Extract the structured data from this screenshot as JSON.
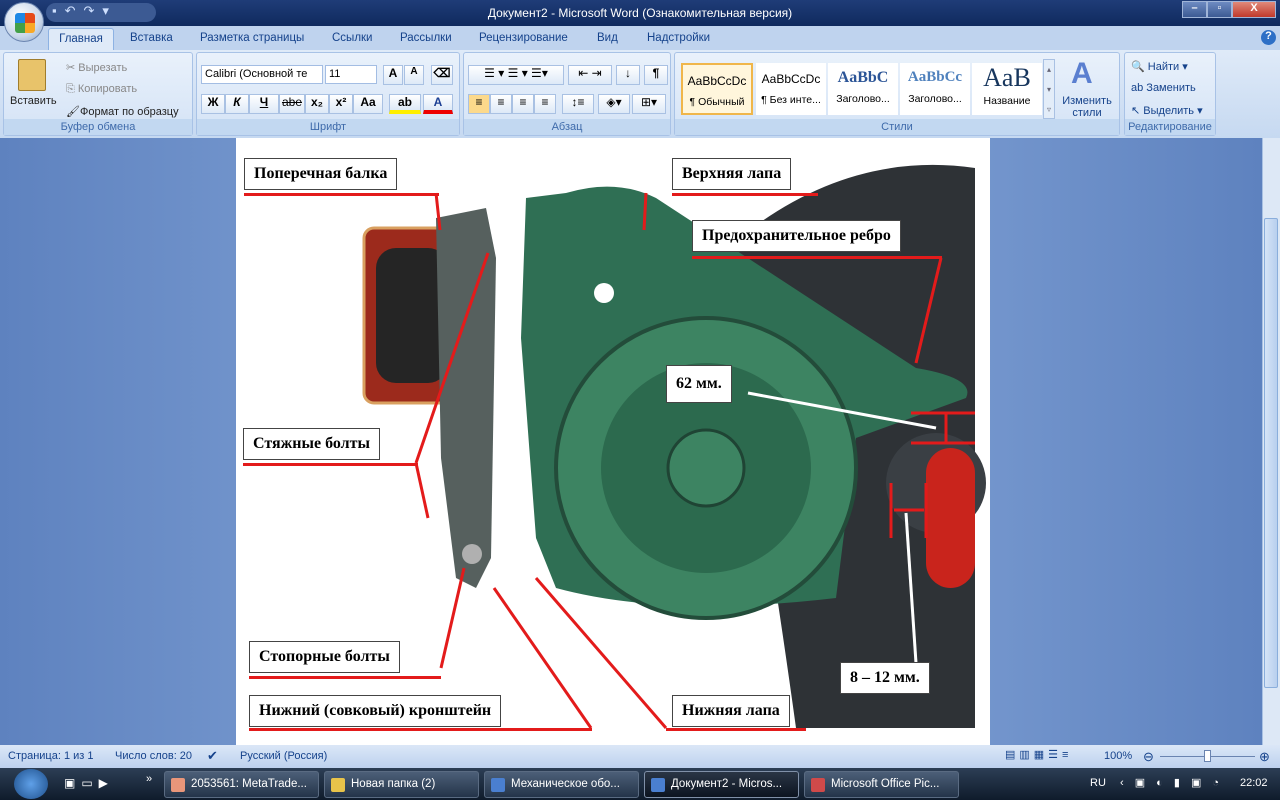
{
  "window": {
    "title": "Документ2 - Microsoft Word (Ознакомительная версия)",
    "min": "–",
    "max": "▫",
    "close": "X"
  },
  "tabs": [
    "Главная",
    "Вставка",
    "Разметка страницы",
    "Ссылки",
    "Рассылки",
    "Рецензирование",
    "Вид",
    "Надстройки"
  ],
  "clipboard": {
    "paste": "Вставить",
    "cut": "Вырезать",
    "copy": "Копировать",
    "format_painter": "Формат по образцу",
    "label": "Буфер обмена"
  },
  "font": {
    "name": "Calibri (Основной те",
    "size": "11",
    "bold": "Ж",
    "italic": "К",
    "underline": "Ч",
    "strike": "abe",
    "sub": "x₂",
    "sup": "x²",
    "case": "Aa",
    "grow": "A",
    "shrink": "A",
    "label": "Шрифт"
  },
  "paragraph": {
    "label": "Абзац",
    "pilcrow": "¶"
  },
  "styles": {
    "items": [
      {
        "preview": "AaBbCcDc",
        "name": "¶ Обычный"
      },
      {
        "preview": "AaBbCcDc",
        "name": "¶ Без инте..."
      },
      {
        "preview": "AaBbC",
        "name": "Заголово..."
      },
      {
        "preview": "AaBbCc",
        "name": "Заголово..."
      },
      {
        "preview": "AaB",
        "name": "Название"
      }
    ],
    "change": "Изменить стили",
    "label": "Стили"
  },
  "editing": {
    "find": "Найти",
    "replace": "Заменить",
    "select": "Выделить",
    "label": "Редактирование"
  },
  "figure": {
    "labels": {
      "cross_beam": "Поперечная балка",
      "upper_paw": "Верхняя лапа",
      "safety_rib": "Предохранительное ребро",
      "dim62": "62 мм.",
      "tie_bolts": "Стяжные болты",
      "lock_bolts": "Стопорные болты",
      "lower_bracket": "Нижний (совковый) кронштейн",
      "lower_paw": "Нижняя лапа",
      "dim8_12": "8 – 12 мм."
    }
  },
  "status": {
    "page": "Страница: 1 из 1",
    "words": "Число слов: 20",
    "lang": "Русский (Россия)",
    "zoom": "100%"
  },
  "zoom_level_percent": 100,
  "taskbar": {
    "items": [
      "2053561: MetaTrade...",
      "Новая папка (2)",
      "Механическое обо...",
      "Документ2 - Micros...",
      "Microsoft Office Pic..."
    ],
    "lang": "RU",
    "time": "22:02"
  }
}
